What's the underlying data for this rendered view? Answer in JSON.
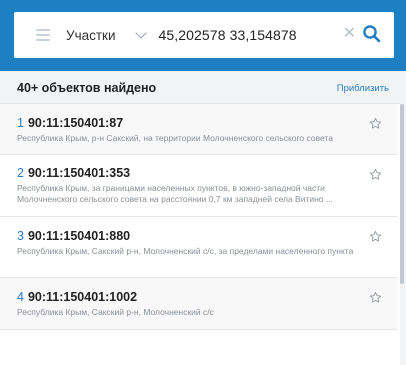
{
  "search": {
    "category": "Участки",
    "query": "45,202578 33,154878"
  },
  "results": {
    "count_label": "40+ объектов найдено",
    "zoom_label": "Приблизить",
    "items": [
      {
        "num": "1",
        "title": "90:11:150401:87",
        "address": "Республика Крым, р-н Сакский, на территории Молочненского сельского совета"
      },
      {
        "num": "2",
        "title": "90:11:150401:353",
        "address": "Республика Крым, за границами населенных пунктов, в южно-западной части Молочненского сельского совета на расстоянии 0,7 км западней села Витино ..."
      },
      {
        "num": "3",
        "title": "90:11:150401:880",
        "address": "Республика Крым, Сакский р-н, Молочненский с/с, за пределами населенного пункта"
      },
      {
        "num": "4",
        "title": "90:11:150401:1002",
        "address": "Республика Крым, Сакский р-н, Молочненский с/с"
      }
    ]
  },
  "colors": {
    "header_bg": "#1E7FC3",
    "accent": "#2a7fc4"
  },
  "icons": [
    "menu-icon",
    "chevron-down-icon",
    "close-icon",
    "search-icon",
    "star-icon"
  ]
}
